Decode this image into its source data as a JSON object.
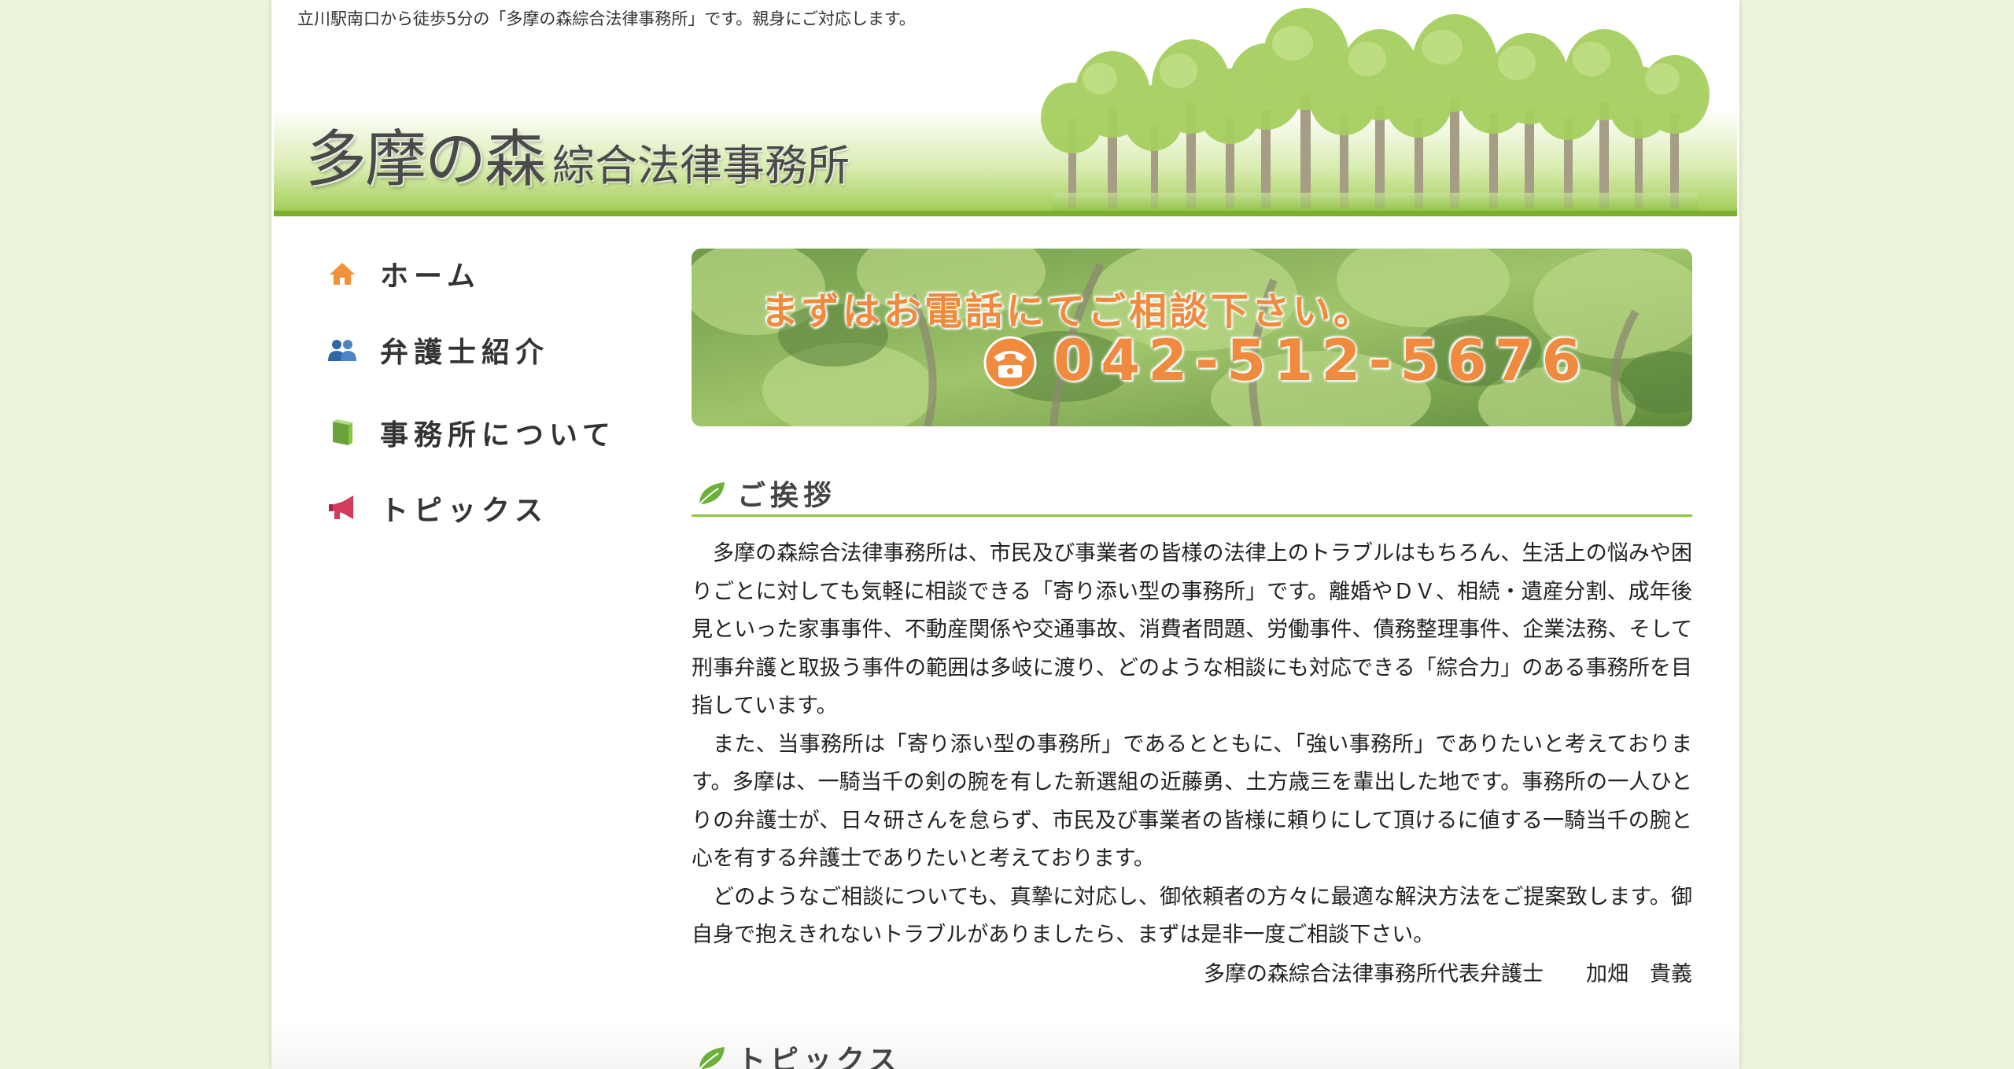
{
  "tagline": "立川駅南口から徒歩5分の「多摩の森綜合法律事務所」です。親身にご対応します。",
  "logo": {
    "main": "多摩の森",
    "sub": "綜合法律事務所"
  },
  "nav": {
    "items": [
      {
        "label": "ホーム",
        "icon": "home-icon"
      },
      {
        "label": "弁護士紹介",
        "icon": "people-icon"
      },
      {
        "label": "事務所について",
        "icon": "book-icon"
      },
      {
        "label": "トピックス",
        "icon": "megaphone-icon"
      }
    ]
  },
  "banner": {
    "headline": "まずはお電話にてご相談下さい。",
    "phone": "042-512-5676",
    "icon": "telephone-icon"
  },
  "greeting": {
    "heading": "ご挨拶",
    "paragraphs": [
      "多摩の森綜合法律事務所は、市民及び事業者の皆様の法律上のトラブルはもちろん、生活上の悩みや困りごとに対しても気軽に相談できる「寄り添い型の事務所」です。離婚やＤＶ、相続・遺産分割、成年後見といった家事事件、不動産関係や交通事故、消費者問題、労働事件、債務整理事件、企業法務、そして刑事弁護と取扱う事件の範囲は多岐に渡り、どのような相談にも対応できる「綜合力」のある事務所を目指しています。",
      "また、当事務所は「寄り添い型の事務所」であるとともに、「強い事務所」でありたいと考えております。多摩は、一騎当千の剣の腕を有した新選組の近藤勇、土方歳三を輩出した地です。事務所の一人ひとりの弁護士が、日々研さんを怠らず、市民及び事業者の皆様に頼りにして頂けるに値する一騎当千の腕と心を有する弁護士でありたいと考えております。",
      "どのようなご相談についても、真摯に対応し、御依頼者の方々に最適な解決方法をご提案致します。御自身で抱えきれないトラブルがありましたら、まずは是非一度ご相談下さい。"
    ],
    "signature": "多摩の森綜合法律事務所代表弁護士　　加畑　貴義"
  },
  "topics": {
    "heading": "トピックス"
  },
  "colors": {
    "background": "#edf4dc",
    "accent_green": "#8cc63f",
    "orange": "#f08a3e",
    "text": "#333333"
  }
}
